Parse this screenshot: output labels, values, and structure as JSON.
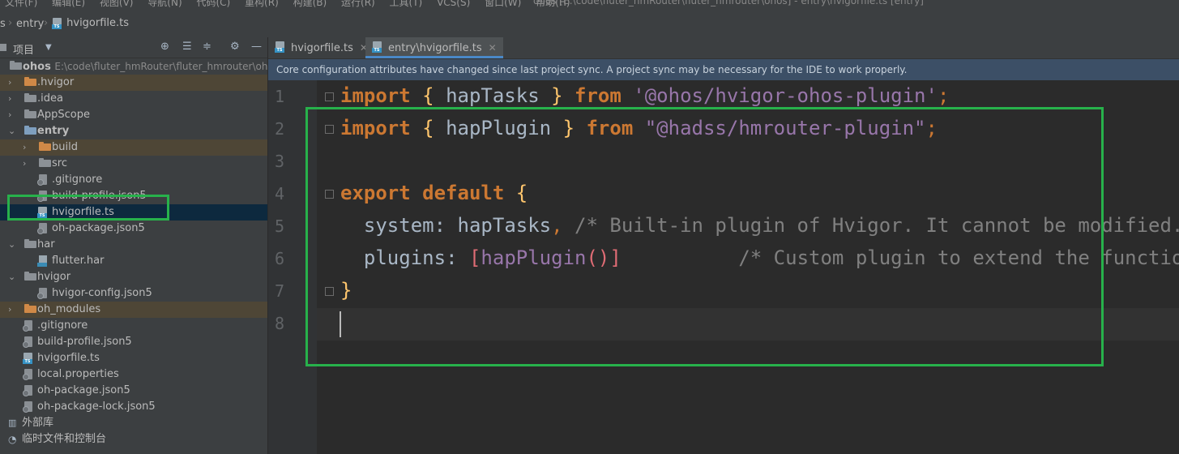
{
  "menubar": {
    "items": [
      "文件(F)",
      "编辑(E)",
      "视图(V)",
      "导航(N)",
      "代码(C)",
      "重构(R)",
      "构建(B)",
      "运行(R)",
      "工具(T)",
      "VCS(S)",
      "窗口(W)",
      "帮助(H)"
    ],
    "window_title": "ohos [E:\\code\\fluter_hmRouter\\fluter_hmrouter\\ohos] - entry\\hvigorfile.ts [entry]"
  },
  "breadcrumb": {
    "root": "s",
    "folder": "entry",
    "file": "hvigorfile.ts"
  },
  "project_panel": {
    "title": "项目",
    "tree": [
      {
        "label": "ohos",
        "path": "E:\\code\\fluter_hmRouter\\fluter_hmrouter\\ohos",
        "depth": 0,
        "expanded": true,
        "icon": "folder-gray-icon",
        "bold": true
      },
      {
        "label": ".hvigor",
        "depth": 1,
        "expanded": false,
        "icon": "folder-orange-icon",
        "excluded": true
      },
      {
        "label": ".idea",
        "depth": 1,
        "expanded": false,
        "icon": "folder-gray-icon"
      },
      {
        "label": "AppScope",
        "depth": 1,
        "expanded": false,
        "icon": "folder-gray-icon"
      },
      {
        "label": "entry",
        "depth": 1,
        "expanded": true,
        "icon": "folder-blue-icon",
        "bold": true
      },
      {
        "label": "build",
        "depth": 2,
        "expanded": false,
        "icon": "folder-orange-icon",
        "excluded": true
      },
      {
        "label": "src",
        "depth": 2,
        "expanded": false,
        "icon": "folder-gray-icon"
      },
      {
        "label": ".gitignore",
        "depth": 2,
        "icon": "config-file-icon"
      },
      {
        "label": "build-profile.json5",
        "depth": 2,
        "icon": "config-file-icon"
      },
      {
        "label": "hvigorfile.ts",
        "depth": 2,
        "icon": "ts-file-icon",
        "selected": true
      },
      {
        "label": "oh-package.json5",
        "depth": 2,
        "icon": "config-file-icon"
      },
      {
        "label": "har",
        "depth": 1,
        "expanded": true,
        "icon": "folder-gray-icon"
      },
      {
        "label": "flutter.har",
        "depth": 2,
        "icon": "har-file-icon"
      },
      {
        "label": "hvigor",
        "depth": 1,
        "expanded": true,
        "icon": "folder-gray-icon"
      },
      {
        "label": "hvigor-config.json5",
        "depth": 2,
        "icon": "config-file-icon"
      },
      {
        "label": "oh_modules",
        "depth": 1,
        "expanded": false,
        "icon": "folder-orange-icon",
        "excluded": true
      },
      {
        "label": ".gitignore",
        "depth": 1,
        "icon": "config-file-icon"
      },
      {
        "label": "build-profile.json5",
        "depth": 1,
        "icon": "config-file-icon"
      },
      {
        "label": "hvigorfile.ts",
        "depth": 1,
        "icon": "ts-file-icon"
      },
      {
        "label": "local.properties",
        "depth": 1,
        "icon": "config-file-icon"
      },
      {
        "label": "oh-package.json5",
        "depth": 1,
        "icon": "config-file-icon"
      },
      {
        "label": "oh-package-lock.json5",
        "depth": 1,
        "icon": "config-file-icon"
      }
    ],
    "external_libs": "外部库",
    "scratches": "临时文件和控制台"
  },
  "tabs": [
    {
      "label": "hvigorfile.ts",
      "active": false
    },
    {
      "label": "entry\\hvigorfile.ts",
      "active": true
    }
  ],
  "banner": "Core configuration attributes have changed since last project sync. A project sync may be necessary for the IDE to work properly.",
  "editor": {
    "line_numbers": [
      "1",
      "2",
      "3",
      "4",
      "5",
      "6",
      "7",
      "8"
    ],
    "line1": {
      "kw1": "import",
      "ob": "{",
      "name": "hapTasks",
      "cb": "}",
      "kw2": "from",
      "str": "'@ohos/hvigor-ohos-plugin'",
      "end": ";"
    },
    "line2": {
      "kw1": "import",
      "ob": "{",
      "name": "hapPlugin",
      "cb": "}",
      "kw2": "from",
      "str": "\"@hadss/hmrouter-plugin\"",
      "end": ";"
    },
    "line4": {
      "kw1": "export",
      "kw2": "default",
      "ob": "{"
    },
    "line5": {
      "prop": "system",
      "colon": ":",
      "val": "hapTasks",
      "comma": ",",
      "comment": "/* Built-in plugin of Hvigor. It cannot be modified. */"
    },
    "line6": {
      "prop": "plugins",
      "colon": ":",
      "ob": "[",
      "fn": "hapPlugin",
      "paren": "()",
      "cb": "]",
      "comment": "/* Custom plugin to extend the functionality of Hvigor. */"
    },
    "line7": {
      "cb": "}"
    }
  },
  "colors": {
    "highlight_box": "#27b14b",
    "selection": "#0d293e",
    "accent": "#4a88c7"
  }
}
